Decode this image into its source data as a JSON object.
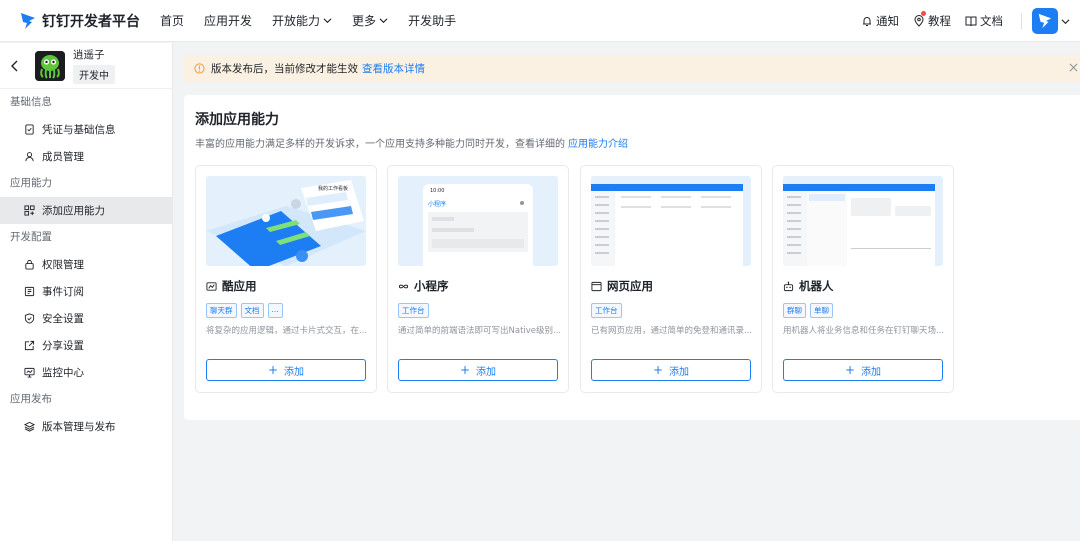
{
  "brand": {
    "name": "钉钉开发者平台"
  },
  "nav": [
    {
      "label": "首页",
      "has_menu": false
    },
    {
      "label": "应用开发",
      "has_menu": false
    },
    {
      "label": "开放能力",
      "has_menu": true
    },
    {
      "label": "更多",
      "has_menu": true
    },
    {
      "label": "开发助手",
      "has_menu": false
    }
  ],
  "top_right": {
    "notify": "通知",
    "tutorial": "教程",
    "docs": "文档"
  },
  "app": {
    "name": "逍遥子",
    "status": "开发中"
  },
  "sidebar": {
    "groups": [
      {
        "title": "基础信息",
        "items": [
          {
            "label": "凭证与基础信息",
            "icon": "credential-icon"
          },
          {
            "label": "成员管理",
            "icon": "user-icon"
          }
        ]
      },
      {
        "title": "应用能力",
        "items": [
          {
            "label": "添加应用能力",
            "icon": "grid-plus-icon",
            "active": true
          }
        ]
      },
      {
        "title": "开发配置",
        "items": [
          {
            "label": "权限管理",
            "icon": "lock-icon"
          },
          {
            "label": "事件订阅",
            "icon": "event-icon"
          },
          {
            "label": "安全设置",
            "icon": "shield-icon"
          },
          {
            "label": "分享设置",
            "icon": "share-icon"
          },
          {
            "label": "监控中心",
            "icon": "monitor-icon"
          }
        ]
      },
      {
        "title": "应用发布",
        "items": [
          {
            "label": "版本管理与发布",
            "icon": "layers-icon"
          }
        ]
      }
    ]
  },
  "notice": {
    "text": "版本发布后，当前修改才能生效",
    "link": "查看版本详情"
  },
  "panel": {
    "title": "添加应用能力",
    "desc": "丰富的应用能力满足多样的开发诉求，一个应用支持多种能力同时开发，查看详细的",
    "desc_link": "应用能力介绍"
  },
  "cards": [
    {
      "title": "酷应用",
      "tags": [
        "聊天群",
        "文档",
        "..."
      ],
      "desc": "将复杂的应用逻辑，通过卡片式交互，在...",
      "button": "添加"
    },
    {
      "title": "小程序",
      "tags": [
        "工作台"
      ],
      "desc": "通过简单的前端语法即可写出Native级别...",
      "button": "添加"
    },
    {
      "title": "网页应用",
      "tags": [
        "工作台"
      ],
      "desc": "已有网页应用，通过简单的免登和通讯录...",
      "button": "添加"
    },
    {
      "title": "机器人",
      "tags": [
        "群聊",
        "单聊"
      ],
      "desc": "用机器人将业务信息和任务在钉钉聊天场...",
      "button": "添加"
    }
  ],
  "preview": {
    "miniapp_time": "10:00",
    "miniapp_title": "小程序",
    "coolapp_label": "我的工作看板"
  },
  "colors": {
    "accent": "#1d7df2",
    "notice_bg": "#fbf1e2",
    "sidebar_active": "#e8e9eb"
  }
}
